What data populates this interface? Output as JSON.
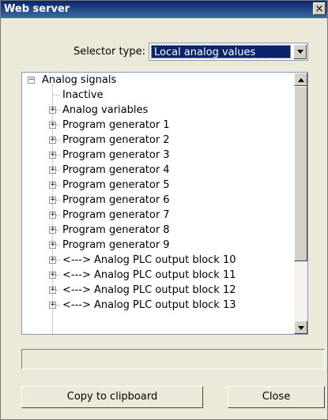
{
  "window": {
    "title": "Web server",
    "close_glyph": "×"
  },
  "selector": {
    "label": "Selector type:",
    "value": "Local analog values"
  },
  "tree": {
    "root": {
      "label": "Analog signals",
      "expander": "−"
    },
    "items": [
      {
        "label": "Inactive",
        "expander": ""
      },
      {
        "label": "Analog variables",
        "expander": "+"
      },
      {
        "label": "Program generator 1",
        "expander": "+"
      },
      {
        "label": "Program generator 2",
        "expander": "+"
      },
      {
        "label": "Program generator 3",
        "expander": "+"
      },
      {
        "label": "Program generator 4",
        "expander": "+"
      },
      {
        "label": "Program generator 5",
        "expander": "+"
      },
      {
        "label": "Program generator 6",
        "expander": "+"
      },
      {
        "label": "Program generator 7",
        "expander": "+"
      },
      {
        "label": "Program generator 8",
        "expander": "+"
      },
      {
        "label": "Program generator 9",
        "expander": "+"
      },
      {
        "label": "<---> Analog PLC output block 10",
        "expander": "+"
      },
      {
        "label": "<---> Analog PLC output block 11",
        "expander": "+"
      },
      {
        "label": "<---> Analog PLC output block 12",
        "expander": "+"
      },
      {
        "label": "<---> Analog PLC output block 13",
        "expander": "+"
      }
    ]
  },
  "status_text": "",
  "buttons": {
    "copy": "Copy to clipboard",
    "close": "Close"
  }
}
